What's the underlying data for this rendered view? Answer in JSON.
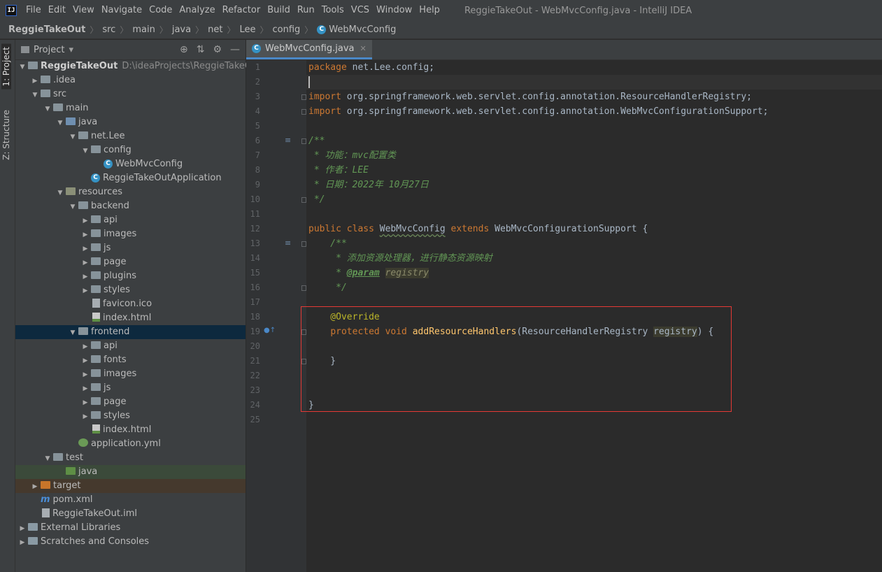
{
  "menubar": {
    "logo": "IJ",
    "items": [
      "File",
      "Edit",
      "View",
      "Navigate",
      "Code",
      "Analyze",
      "Refactor",
      "Build",
      "Run",
      "Tools",
      "VCS",
      "Window",
      "Help"
    ],
    "window_title": "ReggieTakeOut - WebMvcConfig.java - IntelliJ IDEA"
  },
  "breadcrumb": {
    "items": [
      "ReggieTakeOut",
      "src",
      "main",
      "java",
      "net",
      "Lee",
      "config"
    ],
    "current": "WebMvcConfig",
    "class_icon": "C"
  },
  "side_strip": {
    "project_tab": "1: Project",
    "structure_tab": "Z: Structure"
  },
  "project_panel": {
    "title": "Project",
    "dropdown": "▾",
    "tools": [
      "⊕",
      "⇅",
      "⚙",
      "—"
    ],
    "tree": [
      {
        "label": "ReggieTakeOut",
        "suffix": "D:\\ideaProjects\\ReggieTakeOut",
        "depth": 0,
        "arrow": "▼",
        "icon": "folder",
        "bold": true
      },
      {
        "label": ".idea",
        "depth": 1,
        "arrow": "▶",
        "icon": "folder"
      },
      {
        "label": "src",
        "depth": 1,
        "arrow": "▼",
        "icon": "folder"
      },
      {
        "label": "main",
        "depth": 2,
        "arrow": "▼",
        "icon": "folder"
      },
      {
        "label": "java",
        "depth": 3,
        "arrow": "▼",
        "icon": "src"
      },
      {
        "label": "net.Lee",
        "depth": 4,
        "arrow": "▼",
        "icon": "folder"
      },
      {
        "label": "config",
        "depth": 5,
        "arrow": "▼",
        "icon": "folder"
      },
      {
        "label": "WebMvcConfig",
        "depth": 6,
        "arrow": "",
        "icon": "class"
      },
      {
        "label": "ReggieTakeOutApplication",
        "depth": 5,
        "arrow": "",
        "icon": "class"
      },
      {
        "label": "resources",
        "depth": 3,
        "arrow": "▼",
        "icon": "res"
      },
      {
        "label": "backend",
        "depth": 4,
        "arrow": "▼",
        "icon": "folder"
      },
      {
        "label": "api",
        "depth": 5,
        "arrow": "▶",
        "icon": "folder"
      },
      {
        "label": "images",
        "depth": 5,
        "arrow": "▶",
        "icon": "folder"
      },
      {
        "label": "js",
        "depth": 5,
        "arrow": "▶",
        "icon": "folder"
      },
      {
        "label": "page",
        "depth": 5,
        "arrow": "▶",
        "icon": "folder"
      },
      {
        "label": "plugins",
        "depth": 5,
        "arrow": "▶",
        "icon": "folder"
      },
      {
        "label": "styles",
        "depth": 5,
        "arrow": "▶",
        "icon": "folder"
      },
      {
        "label": "favicon.ico",
        "depth": 5,
        "arrow": "",
        "icon": "file"
      },
      {
        "label": "index.html",
        "depth": 5,
        "arrow": "",
        "icon": "html"
      },
      {
        "label": "frontend",
        "depth": 4,
        "arrow": "▼",
        "icon": "folder",
        "state": "sel"
      },
      {
        "label": "api",
        "depth": 5,
        "arrow": "▶",
        "icon": "folder"
      },
      {
        "label": "fonts",
        "depth": 5,
        "arrow": "▶",
        "icon": "folder"
      },
      {
        "label": "images",
        "depth": 5,
        "arrow": "▶",
        "icon": "folder"
      },
      {
        "label": "js",
        "depth": 5,
        "arrow": "▶",
        "icon": "folder"
      },
      {
        "label": "page",
        "depth": 5,
        "arrow": "▶",
        "icon": "folder"
      },
      {
        "label": "styles",
        "depth": 5,
        "arrow": "▶",
        "icon": "folder"
      },
      {
        "label": "index.html",
        "depth": 5,
        "arrow": "",
        "icon": "html"
      },
      {
        "label": "application.yml",
        "depth": 4,
        "arrow": "",
        "icon": "yml"
      },
      {
        "label": "test",
        "depth": 2,
        "arrow": "▼",
        "icon": "folder"
      },
      {
        "label": "java",
        "depth": 3,
        "arrow": "",
        "icon": "green",
        "state": "green"
      },
      {
        "label": "target",
        "depth": 1,
        "arrow": "▶",
        "icon": "orange",
        "state": "orange"
      },
      {
        "label": "pom.xml",
        "depth": 1,
        "arrow": "",
        "icon": "maven"
      },
      {
        "label": "ReggieTakeOut.iml",
        "depth": 1,
        "arrow": "",
        "icon": "file"
      },
      {
        "label": "External Libraries",
        "depth": 0,
        "arrow": "▶",
        "icon": "lib"
      },
      {
        "label": "Scratches and Consoles",
        "depth": 0,
        "arrow": "▶",
        "icon": "lib"
      }
    ]
  },
  "editor_tab": {
    "icon": "C",
    "label": "WebMvcConfig.java",
    "close": "✕"
  },
  "code": {
    "line_numbers": [
      "1",
      "2",
      "3",
      "4",
      "5",
      "6",
      "7",
      "8",
      "9",
      "10",
      "11",
      "12",
      "13",
      "14",
      "15",
      "16",
      "17",
      "18",
      "19",
      "20",
      "21",
      "22",
      "23",
      "24",
      "25"
    ],
    "l1_kw": "package",
    "l1_rest": " net.Lee.config;",
    "l3_kw": "import",
    "l3_rest": " org.springframework.web.servlet.config.annotation.ResourceHandlerRegistry;",
    "l4_kw": "import",
    "l4_rest": " org.springframework.web.servlet.config.annotation.WebMvcConfigurationSupport;",
    "l6": "/**",
    "l7": " * 功能：mvc配置类",
    "l8": " * 作者：LEE",
    "l9": " * 日期：2022年 10月27日",
    "l10": " */",
    "l12_kw": "public class ",
    "l12_cls": "WebMvcConfig",
    "l12_kw2": " extends ",
    "l12_rest": "WebMvcConfigurationSupport {",
    "l13": "    /**",
    "l14": "     * 添加资源处理器，进行静态资源映射",
    "l15_pre": "     * ",
    "l15_tag": "@param",
    "l15_param": "registry",
    "l16": "     */",
    "l18": "    @Override",
    "l19_pre": "    ",
    "l19_kw": "protected void ",
    "l19_fn": "addResourceHandlers",
    "l19_mid": "(ResourceHandlerRegistry ",
    "l19_param": "registry",
    "l19_end": ") {",
    "l21": "    }",
    "l24": "}"
  }
}
